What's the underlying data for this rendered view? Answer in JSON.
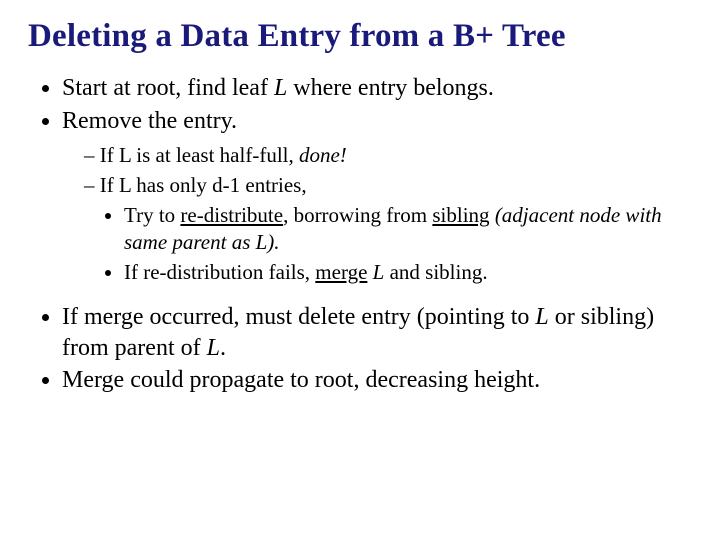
{
  "title": "Deleting a Data Entry from a B+ Tree",
  "b1": {
    "pre": "Start at root, find leaf ",
    "L": "L",
    "post": " where entry belongs."
  },
  "b2": "Remove the entry.",
  "s1": {
    "pre": "If L is at least half-full, ",
    "done": "done!"
  },
  "s2": {
    "pre": "If L has only ",
    "d1": "d-1",
    "post": " entries,"
  },
  "t1": {
    "pre": "Try to ",
    "redist": "re-distribute",
    "mid": ", borrowing from ",
    "sib": "sibling",
    "paren": " (adjacent node with same parent as L)."
  },
  "t2": {
    "pre": "If re-distribution fails, ",
    "merge": "merge",
    "mid": " ",
    "L": "L",
    "post": " and sibling."
  },
  "b3": {
    "pre": "If merge occurred, must delete entry (pointing to ",
    "L1": "L",
    "mid": " or sibling) from parent of ",
    "L2": "L",
    "post": "."
  },
  "b4": "Merge could propagate to root, decreasing height."
}
